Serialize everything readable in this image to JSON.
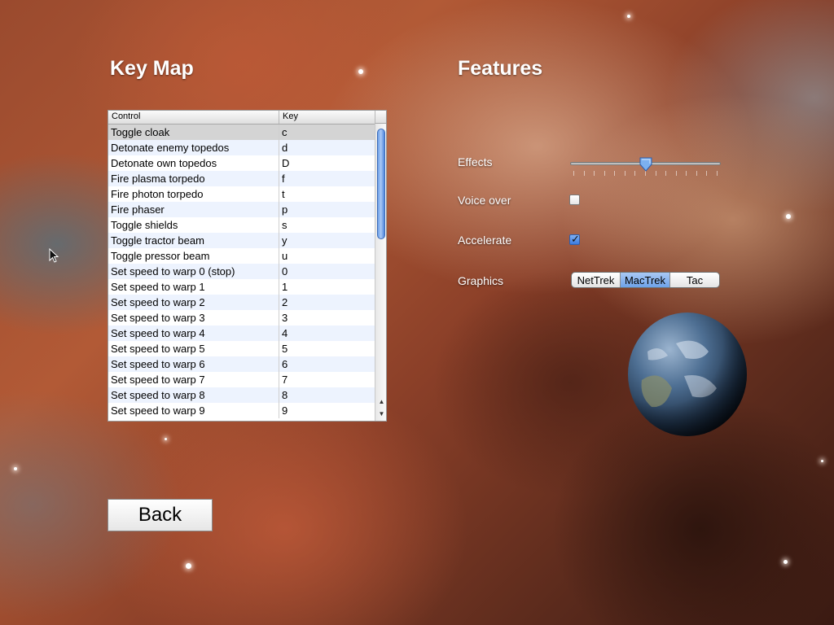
{
  "keymap": {
    "title": "Key Map",
    "columns": [
      "Control",
      "Key"
    ],
    "rows": [
      {
        "control": "Toggle cloak",
        "key": "c"
      },
      {
        "control": "Detonate enemy topedos",
        "key": "d"
      },
      {
        "control": "Detonate own topedos",
        "key": "D"
      },
      {
        "control": "Fire plasma torpedo",
        "key": "f"
      },
      {
        "control": "Fire photon torpedo",
        "key": "t"
      },
      {
        "control": "Fire phaser",
        "key": "p"
      },
      {
        "control": "Toggle shields",
        "key": "s"
      },
      {
        "control": "Toggle tractor beam",
        "key": "y"
      },
      {
        "control": "Toggle pressor beam",
        "key": "u"
      },
      {
        "control": "Set speed to warp 0 (stop)",
        "key": "0"
      },
      {
        "control": "Set speed to warp 1",
        "key": "1"
      },
      {
        "control": "Set speed to warp 2",
        "key": "2"
      },
      {
        "control": "Set speed to warp 3",
        "key": "3"
      },
      {
        "control": "Set speed to warp 4",
        "key": "4"
      },
      {
        "control": "Set speed to warp 5",
        "key": "5"
      },
      {
        "control": "Set speed to warp 6",
        "key": "6"
      },
      {
        "control": "Set speed to warp 7",
        "key": "7"
      },
      {
        "control": "Set speed to warp 8",
        "key": "8"
      },
      {
        "control": "Set speed to warp 9",
        "key": "9"
      }
    ],
    "selected_row": 0
  },
  "features": {
    "title": "Features",
    "effects_label": "Effects",
    "effects_value": 0.5,
    "voice_over_label": "Voice over",
    "voice_over_checked": false,
    "accelerate_label": "Accelerate",
    "accelerate_checked": true,
    "graphics_label": "Graphics",
    "graphics_options": [
      "NetTrek",
      "MacTrek",
      "Tac"
    ],
    "graphics_selected": "MacTrek"
  },
  "back_button": {
    "label": "Back"
  },
  "colors": {
    "selection_blue": "#6ea3ea",
    "row_alt": "#edf3fe",
    "selected_row": "#d4d4d4"
  }
}
